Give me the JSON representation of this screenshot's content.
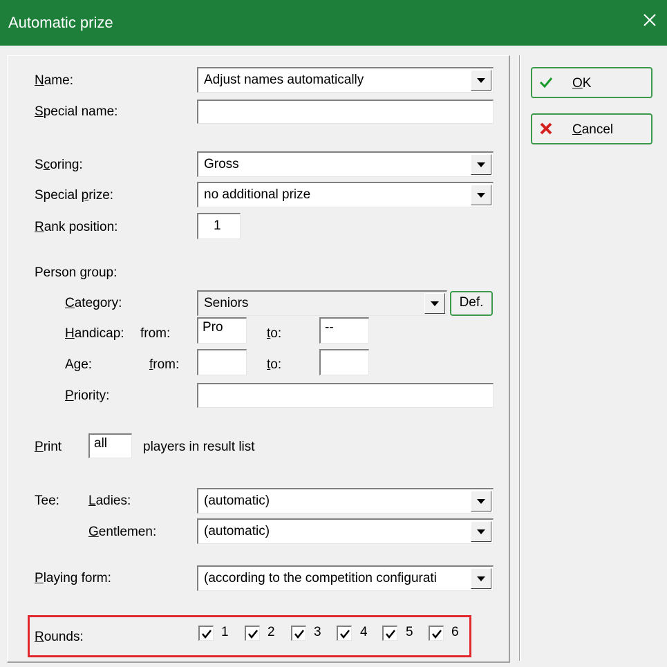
{
  "window": {
    "title": "Automatic prize",
    "close_icon": "close-icon"
  },
  "labels": {
    "name": {
      "pre": "",
      "key": "N",
      "post": "ame:"
    },
    "special_name": {
      "pre": "",
      "key": "S",
      "post": "pecial name:"
    },
    "scoring": {
      "pre": "S",
      "key": "c",
      "post": "oring:"
    },
    "special_prize": {
      "pre": "Special ",
      "key": "p",
      "post": "rize:"
    },
    "rank_position": {
      "pre": "",
      "key": "R",
      "post": "ank position:"
    },
    "person_group": "Person group:",
    "category": {
      "pre": "",
      "key": "C",
      "post": "ategory:"
    },
    "handicap": {
      "pre": "",
      "key": "H",
      "post": "andicap:"
    },
    "handicap_from": "from:",
    "handicap_to": {
      "pre": "",
      "key": "t",
      "post": "o:"
    },
    "age": "Age:",
    "age_from": {
      "pre": "",
      "key": "f",
      "post": "rom:"
    },
    "age_to": {
      "pre": "",
      "key": "t",
      "post": "o:"
    },
    "priority": {
      "pre": "",
      "key": "P",
      "post": "riority:"
    },
    "print": {
      "pre": "",
      "key": "P",
      "post": "rint"
    },
    "players_in_result_list": "players in result list",
    "tee": "Tee:",
    "ladies": {
      "pre": "",
      "key": "L",
      "post": "adies:"
    },
    "gentlemen": {
      "pre": "",
      "key": "G",
      "post": "entlemen:"
    },
    "playing_form": {
      "pre": "",
      "key": "P",
      "post": "laying form:"
    },
    "rounds": {
      "pre": "",
      "key": "R",
      "post": "ounds:"
    }
  },
  "fields": {
    "name_value": "Adjust names automatically",
    "special_name_value": "",
    "scoring_value": "Gross",
    "special_prize_value": "no additional prize",
    "rank_position_value": "1",
    "category_value": "Seniors",
    "handicap_from_value": "Pro",
    "handicap_to_value": "--",
    "age_from_value": "",
    "age_to_value": "",
    "priority_value": "",
    "print_value": "all",
    "ladies_value": "(automatic)",
    "gentlemen_value": "(automatic)",
    "playing_form_value": "(according to the competition configurati"
  },
  "buttons": {
    "ok": {
      "key": "O",
      "post": "K"
    },
    "cancel": {
      "key": "C",
      "post": "ancel"
    },
    "def": "Def."
  },
  "rounds": [
    {
      "label": "1",
      "checked": true
    },
    {
      "label": "2",
      "checked": true
    },
    {
      "label": "3",
      "checked": true
    },
    {
      "label": "4",
      "checked": true
    },
    {
      "label": "5",
      "checked": true
    },
    {
      "label": "6",
      "checked": true
    }
  ],
  "colors": {
    "titlebar": "#1d7f3a",
    "button_border": "#3a9a48",
    "highlight": "#e0282e"
  }
}
